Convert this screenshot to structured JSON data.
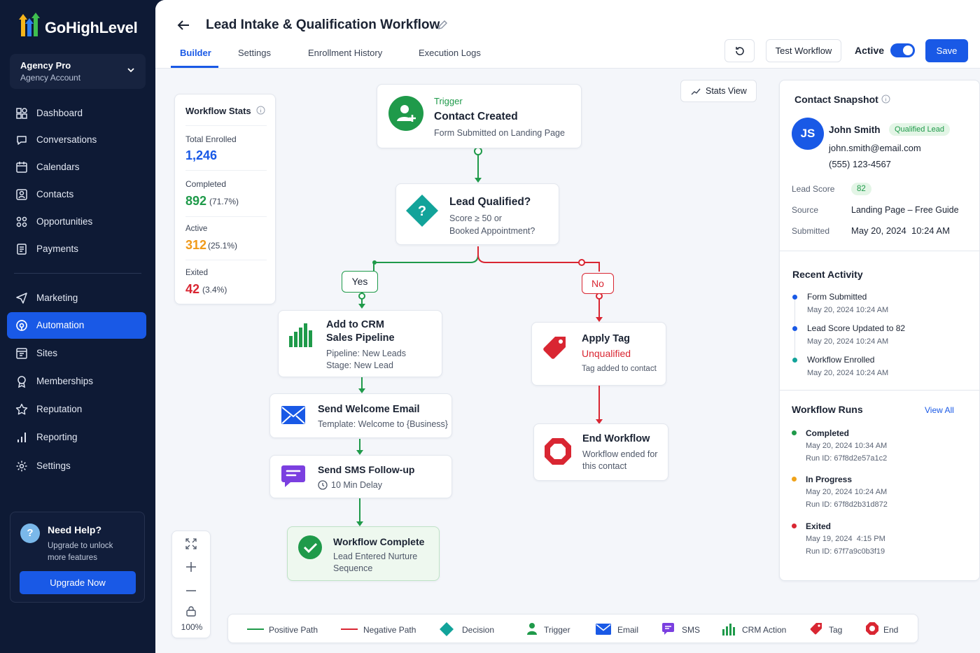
{
  "app": {
    "brand": "GoHighLevel"
  },
  "account": {
    "name": "Agency Pro",
    "type": "Agency Account"
  },
  "nav": [
    {
      "label": "Dashboard",
      "icon": "dashboard-icon"
    },
    {
      "label": "Conversations",
      "icon": "chat-icon"
    },
    {
      "label": "Calendars",
      "icon": "calendar-icon"
    },
    {
      "label": "Contacts",
      "icon": "contacts-icon"
    },
    {
      "label": "Opportunities",
      "icon": "opportunities-icon"
    },
    {
      "label": "Payments",
      "icon": "payments-icon"
    },
    {
      "label": "Marketing",
      "icon": "send-icon"
    },
    {
      "label": "Automation",
      "icon": "automation-icon",
      "active": true
    },
    {
      "label": "Sites",
      "icon": "sites-icon"
    },
    {
      "label": "Memberships",
      "icon": "membership-icon"
    },
    {
      "label": "Reputation",
      "icon": "star-icon"
    },
    {
      "label": "Reporting",
      "icon": "reporting-icon"
    },
    {
      "label": "Settings",
      "icon": "gear-icon"
    }
  ],
  "help": {
    "title": "Need Help?",
    "desc": "Upgrade to unlock more features",
    "button": "Upgrade Now"
  },
  "header": {
    "title": "Lead Intake & Qualification Workflow",
    "tabs": [
      "Builder",
      "Settings",
      "Enrollment History",
      "Execution Logs"
    ],
    "active_tab": "Builder",
    "test_button": "Test Workflow",
    "active_label": "Active",
    "active_on": true,
    "save_button": "Save"
  },
  "stats": {
    "title": "Workflow Stats",
    "items": [
      {
        "label": "Total Enrolled",
        "value": "1,246",
        "pct": "",
        "color": "#1959e6"
      },
      {
        "label": "Completed",
        "value": "892",
        "pct": "(71.7%)",
        "color": "#1f9a4a"
      },
      {
        "label": "Active",
        "value": "312",
        "pct": "(25.1%)",
        "color": "#f09a1a"
      },
      {
        "label": "Exited",
        "value": "42",
        "pct": "(3.4%)",
        "color": "#d92632"
      }
    ]
  },
  "stats_view": "Stats View",
  "nodes": {
    "trigger": {
      "kicker": "Trigger",
      "title": "Contact Created",
      "sub": "Form Submitted on Landing Page"
    },
    "decision": {
      "title": "Lead Qualified?",
      "line1": "Score ≥ 50 or",
      "line2": "Booked Appointment?"
    },
    "yes": "Yes",
    "no": "No",
    "crm": {
      "title1": "Add to CRM",
      "title2": "Sales Pipeline",
      "line1": "Pipeline: New Leads",
      "line2": "Stage: New Lead"
    },
    "email": {
      "title": "Send Welcome Email",
      "sub": "Template: Welcome to {Business}"
    },
    "sms": {
      "title": "Send SMS Follow-up",
      "sub": "10 Min Delay"
    },
    "complete": {
      "title": "Workflow Complete",
      "line1": "Lead Entered Nurture",
      "line2": "Sequence"
    },
    "tag": {
      "title": "Apply Tag",
      "tag": "Unqualified",
      "sub": "Tag added to contact"
    },
    "end": {
      "title": "End Workflow",
      "line1": "Workflow ended for",
      "line2": "this contact"
    }
  },
  "zoom": "100%",
  "legend": [
    "Positive Path",
    "Negative Path",
    "Decision",
    "Trigger",
    "Email",
    "SMS",
    "CRM Action",
    "Tag",
    "End"
  ],
  "contact": {
    "title": "Contact Snapshot",
    "initials": "JS",
    "name": "John Smith",
    "badge": "Qualified Lead",
    "email": "john.smith@email.com",
    "phone": "(555) 123-4567",
    "fields": [
      {
        "label": "Lead Score",
        "value": "82"
      },
      {
        "label": "Source",
        "value": "Landing Page – Free Guide"
      },
      {
        "label": "Submitted",
        "value": "May 20, 2024  10:24 AM"
      }
    ]
  },
  "activity": {
    "title": "Recent Activity",
    "items": [
      {
        "title": "Form Submitted",
        "time": "May 20, 2024 10:24 AM",
        "color": "#1959e6"
      },
      {
        "title": "Lead Score Updated to 82",
        "time": "May 20, 2024 10:24 AM",
        "color": "#1959e6"
      },
      {
        "title": "Workflow Enrolled",
        "time": "May 20, 2024 10:24 AM",
        "color": "#12a39a"
      }
    ]
  },
  "runs": {
    "title": "Workflow Runs",
    "view_all": "View All",
    "items": [
      {
        "status": "Completed",
        "time": "May 20, 2024 10:34 AM",
        "id": "Run ID: 67f8d2e57a1c2",
        "color": "#1f9a4a"
      },
      {
        "status": "In Progress",
        "time": "May 20, 2024 10:24 AM",
        "id": "Run ID: 67f8d2b31d872",
        "color": "#f0a31a"
      },
      {
        "status": "Exited",
        "time": "May 19, 2024  4:15 PM",
        "id": "Run ID: 67f7a9c0b3f19",
        "color": "#d92632"
      }
    ]
  }
}
